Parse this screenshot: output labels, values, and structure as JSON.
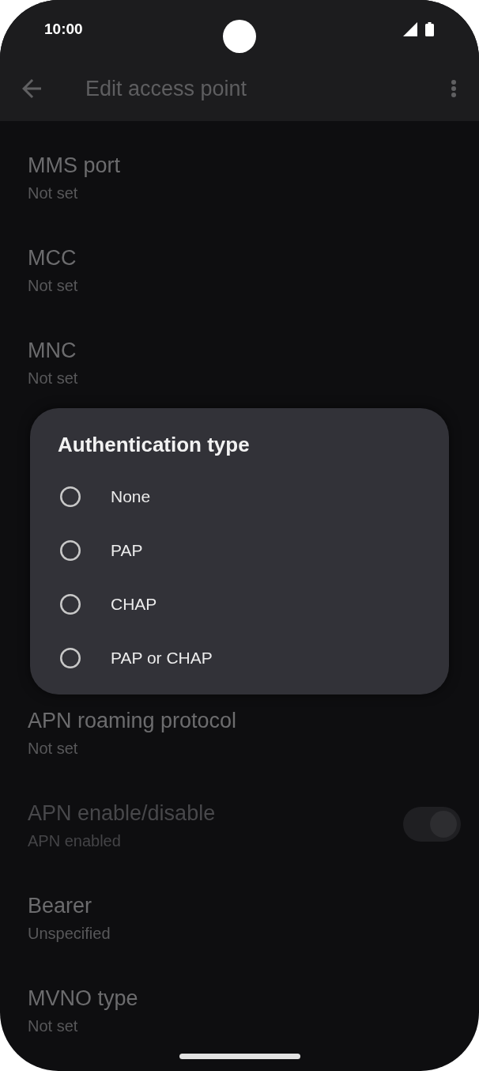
{
  "status_bar": {
    "time": "10:00"
  },
  "app_bar": {
    "title": "Edit access point"
  },
  "settings": {
    "above_dialog": [
      {
        "kind": "text",
        "title": "MMS port",
        "summary": "Not set",
        "disabled": false
      },
      {
        "kind": "text",
        "title": "MCC",
        "summary": "Not set",
        "disabled": false
      },
      {
        "kind": "text",
        "title": "MNC",
        "summary": "Not set",
        "disabled": false
      }
    ],
    "below_dialog": [
      {
        "kind": "text",
        "title": "APN roaming protocol",
        "summary": "Not set",
        "disabled": false
      },
      {
        "kind": "switch",
        "title": "APN enable/disable",
        "summary": "APN enabled",
        "disabled": true,
        "on": true
      },
      {
        "kind": "text",
        "title": "Bearer",
        "summary": "Unspecified",
        "disabled": false
      },
      {
        "kind": "text",
        "title": "MVNO type",
        "summary": "Not set",
        "disabled": false
      }
    ]
  },
  "dialog": {
    "title": "Authentication type",
    "options": [
      {
        "label": "None",
        "selected": false
      },
      {
        "label": "PAP",
        "selected": false
      },
      {
        "label": "CHAP",
        "selected": false
      },
      {
        "label": "PAP or CHAP",
        "selected": false
      }
    ]
  }
}
